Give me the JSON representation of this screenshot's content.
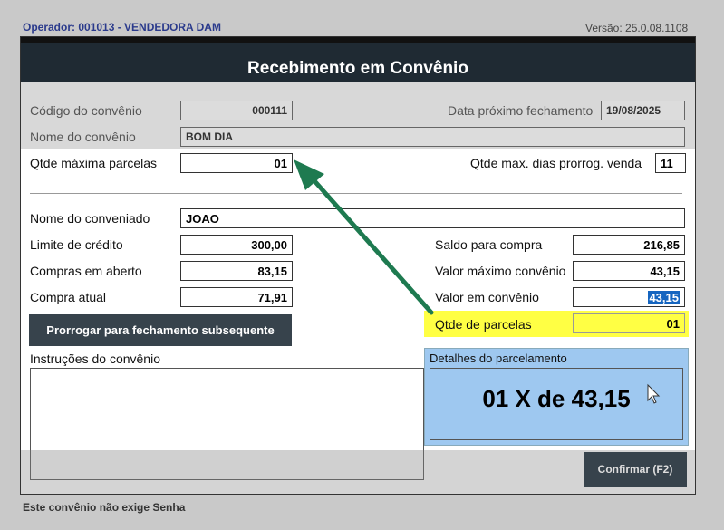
{
  "header": {
    "operator": "Operador: 001013 - VENDEDORA DAM",
    "version": "Versão: 25.0.08.1108"
  },
  "window": {
    "title": "Recebimento em Convênio"
  },
  "convenio": {
    "codigo_label": "Código do convênio",
    "codigo_value": "000111",
    "nome_label": "Nome do convênio",
    "nome_value": "BOM DIA",
    "data_fech_label": "Data próximo fechamento",
    "data_fech_value": "19/08/2025",
    "qtde_max_parcelas_label": "Qtde máxima parcelas",
    "qtde_max_parcelas_value": "01",
    "qtde_max_dias_label": "Qtde max. dias prorrog. venda",
    "qtde_max_dias_value": "11"
  },
  "conveniado": {
    "nome_label": "Nome do conveniado",
    "nome_value": "JOAO",
    "limite_label": "Limite de crédito",
    "limite_value": "300,00",
    "compras_aberto_label": "Compras em aberto",
    "compras_aberto_value": "83,15",
    "compra_atual_label": "Compra atual",
    "compra_atual_value": "71,91",
    "saldo_label": "Saldo para compra",
    "saldo_value": "216,85",
    "valor_max_label": "Valor máximo convênio",
    "valor_max_value": "43,15",
    "valor_conv_label": "Valor em convênio",
    "valor_conv_value": "43,15",
    "qtde_parcelas_label": "Qtde de parcelas",
    "qtde_parcelas_value": "01"
  },
  "actions": {
    "prorrogar_label": "Prorrogar para fechamento subsequente",
    "confirmar_label": "Confirmar (F2)"
  },
  "instrucoes": {
    "label": "Instruções do convênio"
  },
  "detalhes": {
    "label": "Detalhes do parcelamento",
    "text": "01 X de 43,15"
  },
  "footer": {
    "message": "Este convênio não exige Senha"
  },
  "colors": {
    "titlebar": "#1f2a33",
    "highlight_yellow": "#ffff44",
    "annotation_arrow": "#1e7a50",
    "detail_panel": "#9ec8f0"
  },
  "icons": {
    "cursor": "mouse-pointer-icon"
  }
}
